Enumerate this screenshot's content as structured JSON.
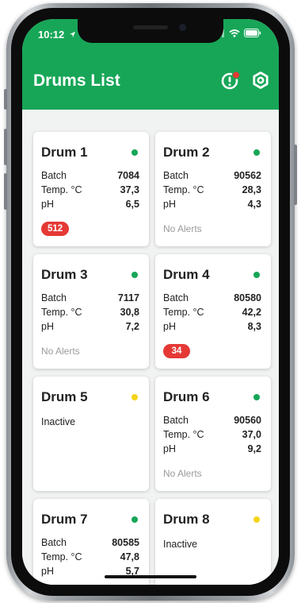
{
  "status_bar": {
    "time": "10:12"
  },
  "header": {
    "title": "Drums List",
    "alert_icon": "alert-icon",
    "settings_icon": "gear-icon"
  },
  "labels": {
    "batch": "Batch",
    "temp": "Temp. °C",
    "ph": "pH",
    "no_alerts": "No Alerts",
    "inactive": "Inactive"
  },
  "colors": {
    "brand": "#17a657",
    "active": "#17a657",
    "inactive": "#f5d418",
    "alert": "#e53935"
  },
  "drums": [
    {
      "name": "Drum 1",
      "status": "active",
      "batch": "7084",
      "temp": "37,3",
      "ph": "6,5",
      "alerts": "512"
    },
    {
      "name": "Drum 2",
      "status": "active",
      "batch": "90562",
      "temp": "28,3",
      "ph": "4,3",
      "alerts": ""
    },
    {
      "name": "Drum 3",
      "status": "active",
      "batch": "7117",
      "temp": "30,8",
      "ph": "7,2",
      "alerts": ""
    },
    {
      "name": "Drum 4",
      "status": "active",
      "batch": "80580",
      "temp": "42,2",
      "ph": "8,3",
      "alerts": "34"
    },
    {
      "name": "Drum 5",
      "status": "inactive",
      "batch": "",
      "temp": "",
      "ph": "",
      "alerts": ""
    },
    {
      "name": "Drum 6",
      "status": "active",
      "batch": "90560",
      "temp": "37,0",
      "ph": "9,2",
      "alerts": ""
    },
    {
      "name": "Drum 7",
      "status": "active",
      "batch": "80585",
      "temp": "47,8",
      "ph": "5,7",
      "alerts": ""
    },
    {
      "name": "Drum 8",
      "status": "inactive",
      "batch": "",
      "temp": "",
      "ph": "",
      "alerts": ""
    }
  ]
}
